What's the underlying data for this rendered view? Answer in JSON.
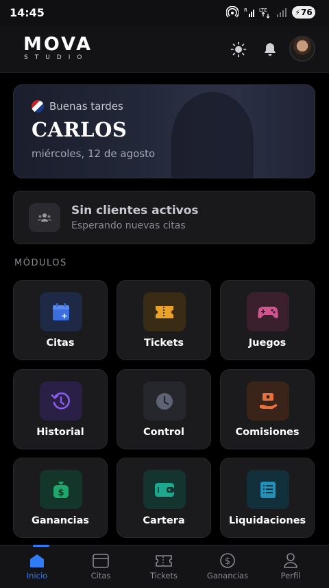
{
  "status": {
    "time": "14:45",
    "battery": "76"
  },
  "header": {
    "logo_main": "MOVA",
    "logo_sub": "STUDIO"
  },
  "hero": {
    "greeting": "Buenas tardes",
    "name": "CARLOS",
    "date": "miércoles, 12 de agosto"
  },
  "clients": {
    "title": "Sin clientes activos",
    "subtitle": "Esperando nuevas citas"
  },
  "section_label": "MÓDULOS",
  "modules": [
    {
      "label": "Citas",
      "icon": "calendar-plus-icon",
      "color": "#3b6fe0"
    },
    {
      "label": "Tickets",
      "icon": "ticket-icon",
      "color": "#e9a227"
    },
    {
      "label": "Juegos",
      "icon": "gamepad-icon",
      "color": "#d0558f"
    },
    {
      "label": "Historial",
      "icon": "history-icon",
      "color": "#8a5cf0"
    },
    {
      "label": "Control",
      "icon": "clock-icon",
      "color": "#5e6474"
    },
    {
      "label": "Comisiones",
      "icon": "commission-hand-icon",
      "color": "#e8703a"
    },
    {
      "label": "Ganancias",
      "icon": "money-bag-icon",
      "color": "#1fa66b"
    },
    {
      "label": "Cartera",
      "icon": "wallet-icon",
      "color": "#1fa68f"
    },
    {
      "label": "Liquidaciones",
      "icon": "receipt-list-icon",
      "color": "#2390b8"
    }
  ],
  "nav": [
    {
      "label": "Inicio",
      "icon": "home-icon",
      "active": true
    },
    {
      "label": "Citas",
      "icon": "calendar-icon"
    },
    {
      "label": "Tickets",
      "icon": "ticket-icon"
    },
    {
      "label": "Ganancias",
      "icon": "dollar-circle-icon"
    },
    {
      "label": "Perfil",
      "icon": "user-icon"
    }
  ],
  "colors": {
    "accent": "#2f7cf6",
    "background": "#000000",
    "card": "#1b1b1e"
  }
}
